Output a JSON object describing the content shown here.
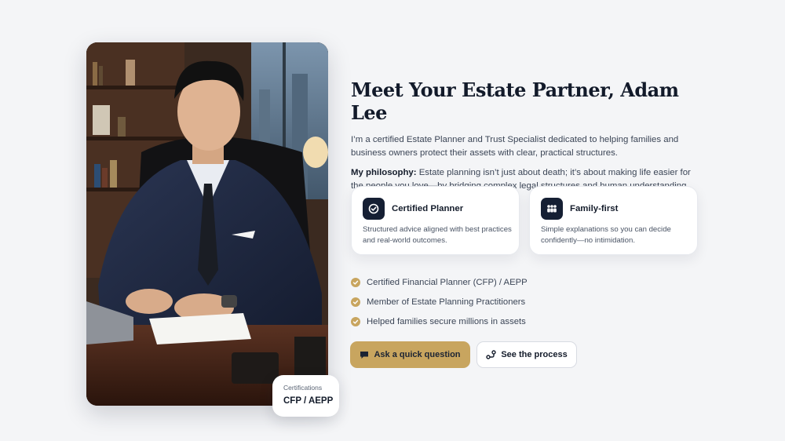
{
  "profile": {
    "photo_alt": "Adam Lee at his desk",
    "badge_label": "Certifications",
    "badge_value": "CFP / AEPP"
  },
  "heading": "Meet Your Estate Partner, Adam Lee",
  "intro": "I’m a certified Estate Planner and Trust Specialist dedicated to helping families and business owners protect their assets with clear, practical structures.",
  "philosophy": {
    "label": "My philosophy:",
    "text": " Estate planning isn’t just about death; it’s about making life easier for the people you love—by bridging complex legal structures and human understanding."
  },
  "cards": [
    {
      "icon": "check-badge-icon",
      "title": "Certified Planner",
      "desc": "Structured advice aligned with best practices and real-world outcomes."
    },
    {
      "icon": "family-icon",
      "title": "Family-first",
      "desc": "Simple explanations so you can decide confidently—no intimidation."
    }
  ],
  "checks": [
    "Certified Financial Planner (CFP) / AEPP",
    "Member of Estate Planning Practitioners",
    "Helped families secure millions in assets"
  ],
  "buttons": {
    "primary": "Ask a quick question",
    "secondary": "See the process"
  },
  "colors": {
    "accent": "#c8a55f",
    "navy": "#151f33",
    "background": "#f4f5f7"
  }
}
